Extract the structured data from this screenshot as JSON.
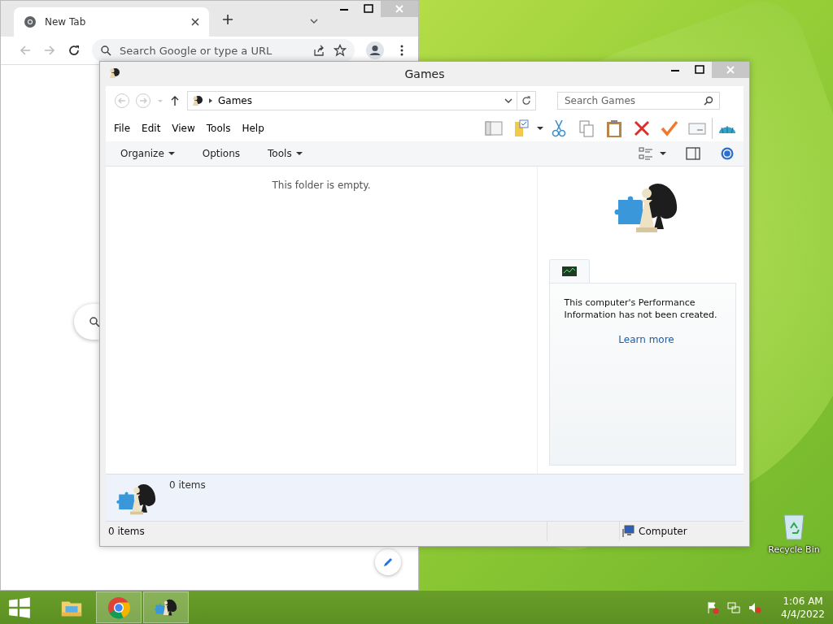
{
  "browser": {
    "tab": {
      "title": "New Tab"
    },
    "omnibox": {
      "placeholder": "Search Google or type a URL"
    }
  },
  "explorer": {
    "title": "Games",
    "address": {
      "crumb": "Games"
    },
    "search": {
      "placeholder": "Search Games"
    },
    "menu": [
      "File",
      "Edit",
      "View",
      "Tools",
      "Help"
    ],
    "commands": [
      {
        "label": "Organize",
        "dropdown": true
      },
      {
        "label": "Options",
        "dropdown": false
      },
      {
        "label": "Tools",
        "dropdown": true
      }
    ],
    "empty_message": "This folder is empty.",
    "performance": {
      "message": "This computer's Performance Information has not been created.",
      "link": "Learn more"
    },
    "details": {
      "count": "0 items"
    },
    "status_bar": {
      "items": "0 items",
      "zone": "Computer"
    }
  },
  "desktop": {
    "icons": [
      {
        "label": "Recycle Bin"
      }
    ]
  },
  "taskbar": {
    "apps": [
      {
        "kind": "explorer",
        "selected": false
      },
      {
        "kind": "chrome",
        "selected": true
      },
      {
        "kind": "games",
        "selected": true
      }
    ],
    "clock": {
      "time": "1:06 AM",
      "date": "4/4/2022"
    }
  }
}
